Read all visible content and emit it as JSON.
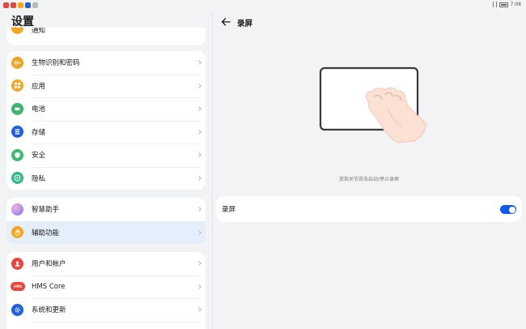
{
  "status_bar": {
    "time": "7:08"
  },
  "settings": {
    "title": "设置",
    "top_partial_label": "通知",
    "groups": [
      {
        "items": [
          {
            "label": "生物识别和密码",
            "icon": "key-icon",
            "color": "#f0a327"
          },
          {
            "label": "应用",
            "icon": "apps-icon",
            "color": "#f5a623"
          },
          {
            "label": "电池",
            "icon": "battery-icon",
            "color": "#3cb371"
          },
          {
            "label": "存储",
            "icon": "storage-icon",
            "color": "#1f5fe0"
          },
          {
            "label": "安全",
            "icon": "shield-icon",
            "color": "#3cba6f"
          },
          {
            "label": "隐私",
            "icon": "privacy-icon",
            "color": "#30b98a"
          }
        ]
      },
      {
        "items": [
          {
            "label": "智慧助手",
            "icon": "assistant-icon",
            "color": "#b38bf0"
          },
          {
            "label": "辅助功能",
            "icon": "hand-icon",
            "color": "#f5a623",
            "selected": true
          }
        ]
      },
      {
        "items": [
          {
            "label": "用户和帐户",
            "icon": "user-icon",
            "color": "#e8463c"
          },
          {
            "label": "HMS Core",
            "icon": "hms-icon",
            "color": "#e8463c",
            "icon_text": "HMS"
          },
          {
            "label": "系统和更新",
            "icon": "system-update-icon",
            "color": "#1f5fe0"
          }
        ]
      }
    ]
  },
  "detail": {
    "title": "录屏",
    "hint": "双指关节双击启动/停止录屏",
    "toggle": {
      "label": "录屏",
      "on": true
    }
  }
}
